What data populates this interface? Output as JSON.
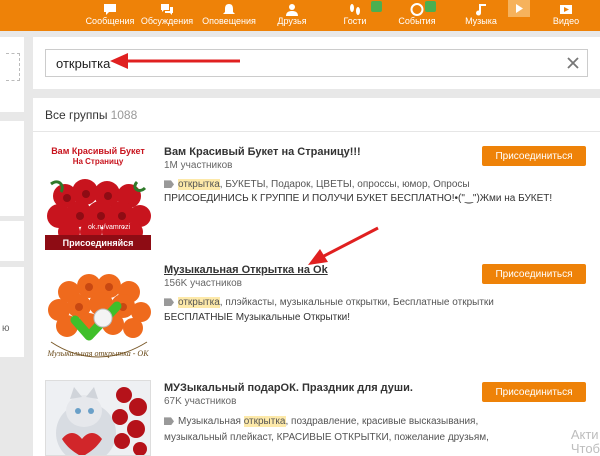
{
  "nav": {
    "items": [
      {
        "label": "Сообщения",
        "icon": "message-icon"
      },
      {
        "label": "Обсуждения",
        "icon": "discussion-icon"
      },
      {
        "label": "Оповещения",
        "icon": "bell-icon"
      },
      {
        "label": "Друзья",
        "icon": "friends-icon"
      },
      {
        "label": "Гости",
        "icon": "footprints-icon"
      },
      {
        "label": "События",
        "icon": "events-icon"
      },
      {
        "label": "Музыка",
        "icon": "music-note-icon"
      },
      {
        "label": "Видео",
        "icon": "video-icon"
      }
    ]
  },
  "search": {
    "value": "открытка"
  },
  "results": {
    "label": "Все группы",
    "count": "1088",
    "join_label": "Присоединиться",
    "groups": [
      {
        "title": "Вам Красивый Букет на Страницу!!!",
        "members": "1M участников",
        "tags": [
          "открытка",
          ", БУКЕТЫ, Подарок, ЦВЕТЫ, опроссы, юмор, Опросы"
        ],
        "desc": "ПРИСОЕДИНИСЬ К ГРУППЕ И ПОЛУЧИ БУКЕТ БЕСПЛАТНО!•(\"‿\")Жми на БУКЕТ!",
        "thumb": {
          "title_line1": "Вам Красивый Букет",
          "title_line2": "На Страницу",
          "site": "ok.ru/vamrozi",
          "banner": "Присоединяйся"
        }
      },
      {
        "title": "Музыкальная Открытка на Ok",
        "members": "156K участников",
        "tags": [
          "открытка",
          ", плэйкасты, музыкальные открытки, Бесплатные открытки"
        ],
        "desc": "БЕСПЛАТНЫЕ Музыкальные Открытки!",
        "thumb": {
          "caption": "Музыкальная открытка - ОК"
        }
      },
      {
        "title": "МУЗыкальный подарОК. Праздник для души.",
        "members": "67K участников",
        "tags": [
          "Музыкальная ",
          "открытка",
          ", поздравление, красивые высказывания,"
        ],
        "tags2": "музыкальный плейкаст, КРАСИВЫЕ ОТКРЫТКИ, пожелание друзьям,"
      }
    ]
  },
  "watermark": {
    "line1": "Акти",
    "line2": "Чтоб"
  },
  "colors": {
    "accent": "#ee8208",
    "arrow": "#e02020",
    "highlight": "#fde9a9"
  }
}
